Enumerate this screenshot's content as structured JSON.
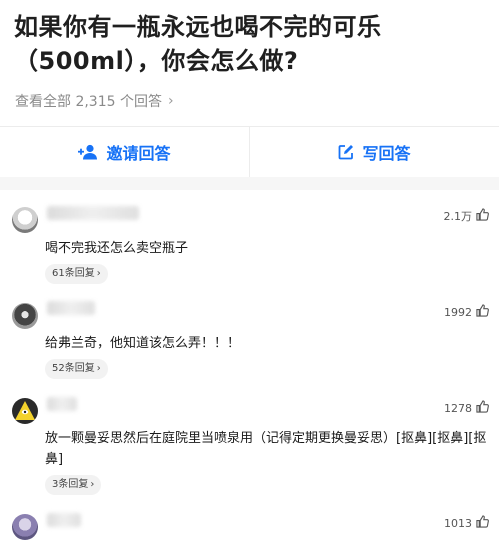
{
  "question": {
    "title": "如果你有一瓶永远也喝不完的可乐（500ml），你会怎么做?",
    "view_all": "查看全部 2,315 个回答"
  },
  "actions": {
    "invite": "邀请回答",
    "write": "写回答"
  },
  "colors": {
    "accent": "#1772f6"
  },
  "comments": [
    {
      "likes": "2.1万",
      "text": "喝不完我还怎么卖空瓶子",
      "replies": "61条回复"
    },
    {
      "likes": "1992",
      "text": "给弗兰奇，他知道该怎么弄！！！",
      "replies": "52条回复"
    },
    {
      "likes": "1278",
      "text": "放一颗曼妥思然后在庭院里当喷泉用（记得定期更换曼妥思）[抠鼻][抠鼻][抠鼻]",
      "replies": "3条回复"
    },
    {
      "likes": "1013"
    }
  ]
}
